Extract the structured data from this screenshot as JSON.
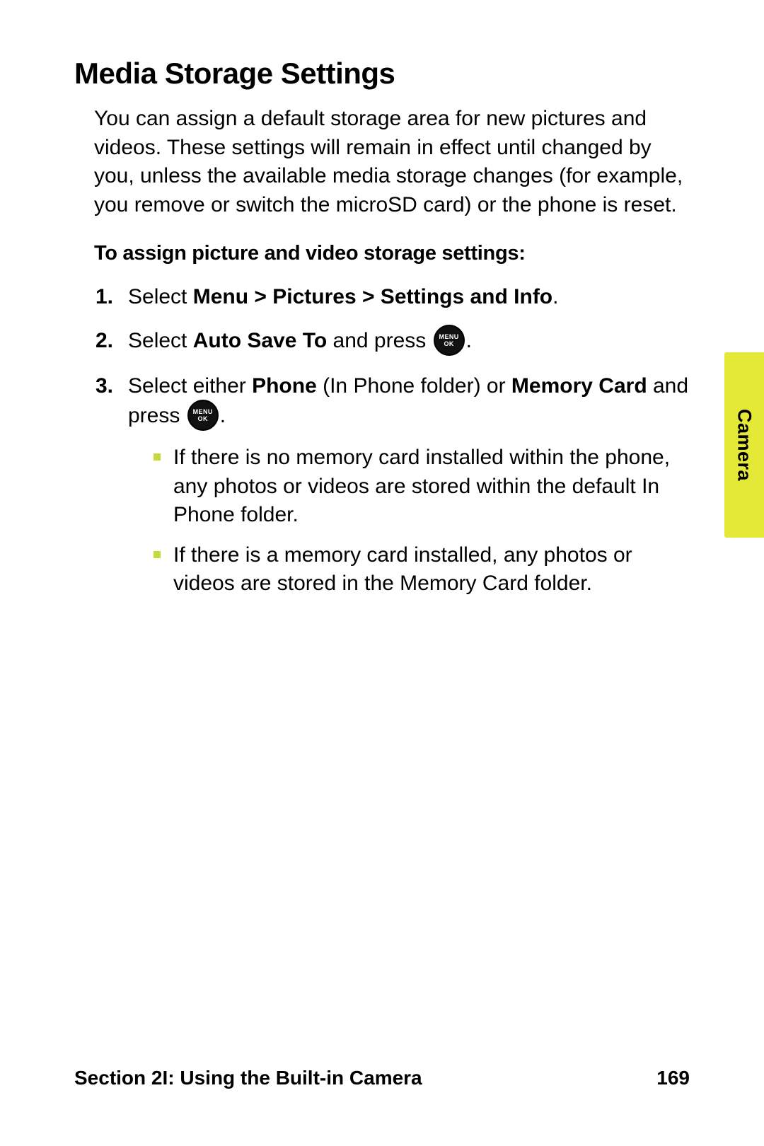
{
  "heading": "Media Storage Settings",
  "intro": "You can assign a default storage area for new pictures and videos. These settings will remain in effect until changed by you, unless the available media storage changes (for example, you remove or switch the microSD card) or the phone is reset.",
  "subhead": "To assign picture and video storage settings:",
  "steps": {
    "s1": {
      "num": "1.",
      "a": "Select ",
      "b": "Menu > Pictures > Settings and Info",
      "c": "."
    },
    "s2": {
      "num": "2.",
      "a": "Select ",
      "b": "Auto Save To",
      "c": " and press ",
      "d": "."
    },
    "s3": {
      "num": "3.",
      "a": "Select either ",
      "b": "Phone",
      "c": " (In Phone folder) or ",
      "d": "Memory Card",
      "e": " and press ",
      "f": "."
    }
  },
  "bullets": {
    "b1": "If there is no memory card installed within the phone, any photos or videos are stored within the default In Phone folder.",
    "b2": "If there is a memory card installed, any photos or videos are stored in the Memory Card folder."
  },
  "menu_key": {
    "top": "MENU",
    "bottom": "OK"
  },
  "tab_label": "Camera",
  "footer": {
    "section": "Section 2I: Using the Built-in Camera",
    "page": "169"
  }
}
